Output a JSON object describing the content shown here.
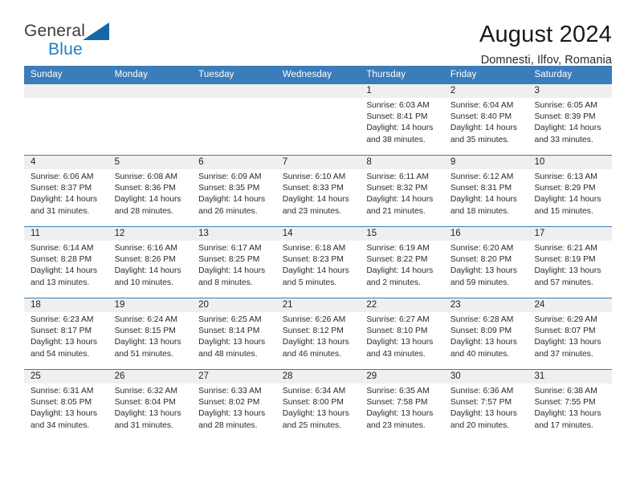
{
  "brand": {
    "name_part1": "General",
    "name_part2": "Blue",
    "triangle_icon": "triangle-icon"
  },
  "header": {
    "title": "August 2024",
    "subtitle": "Domnesti, Ilfov, Romania"
  },
  "calendar": {
    "weekdays": [
      "Sunday",
      "Monday",
      "Tuesday",
      "Wednesday",
      "Thursday",
      "Friday",
      "Saturday"
    ],
    "colors": {
      "header_blue": "#3b7cba",
      "day_band_gray": "#efefef",
      "brand_blue": "#1b7fc4"
    },
    "labels": {
      "sunrise": "Sunrise:",
      "sunset": "Sunset:",
      "daylight": "Daylight:"
    },
    "weeks": [
      [
        {
          "day": "",
          "empty": true
        },
        {
          "day": "",
          "empty": true
        },
        {
          "day": "",
          "empty": true
        },
        {
          "day": "",
          "empty": true
        },
        {
          "day": "1",
          "sunrise": "Sunrise: 6:03 AM",
          "sunset": "Sunset: 8:41 PM",
          "daylight_line1": "Daylight: 14 hours",
          "daylight_line2": "and 38 minutes."
        },
        {
          "day": "2",
          "sunrise": "Sunrise: 6:04 AM",
          "sunset": "Sunset: 8:40 PM",
          "daylight_line1": "Daylight: 14 hours",
          "daylight_line2": "and 35 minutes."
        },
        {
          "day": "3",
          "sunrise": "Sunrise: 6:05 AM",
          "sunset": "Sunset: 8:39 PM",
          "daylight_line1": "Daylight: 14 hours",
          "daylight_line2": "and 33 minutes."
        }
      ],
      [
        {
          "day": "4",
          "sunrise": "Sunrise: 6:06 AM",
          "sunset": "Sunset: 8:37 PM",
          "daylight_line1": "Daylight: 14 hours",
          "daylight_line2": "and 31 minutes."
        },
        {
          "day": "5",
          "sunrise": "Sunrise: 6:08 AM",
          "sunset": "Sunset: 8:36 PM",
          "daylight_line1": "Daylight: 14 hours",
          "daylight_line2": "and 28 minutes."
        },
        {
          "day": "6",
          "sunrise": "Sunrise: 6:09 AM",
          "sunset": "Sunset: 8:35 PM",
          "daylight_line1": "Daylight: 14 hours",
          "daylight_line2": "and 26 minutes."
        },
        {
          "day": "7",
          "sunrise": "Sunrise: 6:10 AM",
          "sunset": "Sunset: 8:33 PM",
          "daylight_line1": "Daylight: 14 hours",
          "daylight_line2": "and 23 minutes."
        },
        {
          "day": "8",
          "sunrise": "Sunrise: 6:11 AM",
          "sunset": "Sunset: 8:32 PM",
          "daylight_line1": "Daylight: 14 hours",
          "daylight_line2": "and 21 minutes."
        },
        {
          "day": "9",
          "sunrise": "Sunrise: 6:12 AM",
          "sunset": "Sunset: 8:31 PM",
          "daylight_line1": "Daylight: 14 hours",
          "daylight_line2": "and 18 minutes."
        },
        {
          "day": "10",
          "sunrise": "Sunrise: 6:13 AM",
          "sunset": "Sunset: 8:29 PM",
          "daylight_line1": "Daylight: 14 hours",
          "daylight_line2": "and 15 minutes."
        }
      ],
      [
        {
          "day": "11",
          "sunrise": "Sunrise: 6:14 AM",
          "sunset": "Sunset: 8:28 PM",
          "daylight_line1": "Daylight: 14 hours",
          "daylight_line2": "and 13 minutes."
        },
        {
          "day": "12",
          "sunrise": "Sunrise: 6:16 AM",
          "sunset": "Sunset: 8:26 PM",
          "daylight_line1": "Daylight: 14 hours",
          "daylight_line2": "and 10 minutes."
        },
        {
          "day": "13",
          "sunrise": "Sunrise: 6:17 AM",
          "sunset": "Sunset: 8:25 PM",
          "daylight_line1": "Daylight: 14 hours",
          "daylight_line2": "and 8 minutes."
        },
        {
          "day": "14",
          "sunrise": "Sunrise: 6:18 AM",
          "sunset": "Sunset: 8:23 PM",
          "daylight_line1": "Daylight: 14 hours",
          "daylight_line2": "and 5 minutes."
        },
        {
          "day": "15",
          "sunrise": "Sunrise: 6:19 AM",
          "sunset": "Sunset: 8:22 PM",
          "daylight_line1": "Daylight: 14 hours",
          "daylight_line2": "and 2 minutes."
        },
        {
          "day": "16",
          "sunrise": "Sunrise: 6:20 AM",
          "sunset": "Sunset: 8:20 PM",
          "daylight_line1": "Daylight: 13 hours",
          "daylight_line2": "and 59 minutes."
        },
        {
          "day": "17",
          "sunrise": "Sunrise: 6:21 AM",
          "sunset": "Sunset: 8:19 PM",
          "daylight_line1": "Daylight: 13 hours",
          "daylight_line2": "and 57 minutes."
        }
      ],
      [
        {
          "day": "18",
          "sunrise": "Sunrise: 6:23 AM",
          "sunset": "Sunset: 8:17 PM",
          "daylight_line1": "Daylight: 13 hours",
          "daylight_line2": "and 54 minutes."
        },
        {
          "day": "19",
          "sunrise": "Sunrise: 6:24 AM",
          "sunset": "Sunset: 8:15 PM",
          "daylight_line1": "Daylight: 13 hours",
          "daylight_line2": "and 51 minutes."
        },
        {
          "day": "20",
          "sunrise": "Sunrise: 6:25 AM",
          "sunset": "Sunset: 8:14 PM",
          "daylight_line1": "Daylight: 13 hours",
          "daylight_line2": "and 48 minutes."
        },
        {
          "day": "21",
          "sunrise": "Sunrise: 6:26 AM",
          "sunset": "Sunset: 8:12 PM",
          "daylight_line1": "Daylight: 13 hours",
          "daylight_line2": "and 46 minutes."
        },
        {
          "day": "22",
          "sunrise": "Sunrise: 6:27 AM",
          "sunset": "Sunset: 8:10 PM",
          "daylight_line1": "Daylight: 13 hours",
          "daylight_line2": "and 43 minutes."
        },
        {
          "day": "23",
          "sunrise": "Sunrise: 6:28 AM",
          "sunset": "Sunset: 8:09 PM",
          "daylight_line1": "Daylight: 13 hours",
          "daylight_line2": "and 40 minutes."
        },
        {
          "day": "24",
          "sunrise": "Sunrise: 6:29 AM",
          "sunset": "Sunset: 8:07 PM",
          "daylight_line1": "Daylight: 13 hours",
          "daylight_line2": "and 37 minutes."
        }
      ],
      [
        {
          "day": "25",
          "sunrise": "Sunrise: 6:31 AM",
          "sunset": "Sunset: 8:05 PM",
          "daylight_line1": "Daylight: 13 hours",
          "daylight_line2": "and 34 minutes."
        },
        {
          "day": "26",
          "sunrise": "Sunrise: 6:32 AM",
          "sunset": "Sunset: 8:04 PM",
          "daylight_line1": "Daylight: 13 hours",
          "daylight_line2": "and 31 minutes."
        },
        {
          "day": "27",
          "sunrise": "Sunrise: 6:33 AM",
          "sunset": "Sunset: 8:02 PM",
          "daylight_line1": "Daylight: 13 hours",
          "daylight_line2": "and 28 minutes."
        },
        {
          "day": "28",
          "sunrise": "Sunrise: 6:34 AM",
          "sunset": "Sunset: 8:00 PM",
          "daylight_line1": "Daylight: 13 hours",
          "daylight_line2": "and 25 minutes."
        },
        {
          "day": "29",
          "sunrise": "Sunrise: 6:35 AM",
          "sunset": "Sunset: 7:58 PM",
          "daylight_line1": "Daylight: 13 hours",
          "daylight_line2": "and 23 minutes."
        },
        {
          "day": "30",
          "sunrise": "Sunrise: 6:36 AM",
          "sunset": "Sunset: 7:57 PM",
          "daylight_line1": "Daylight: 13 hours",
          "daylight_line2": "and 20 minutes."
        },
        {
          "day": "31",
          "sunrise": "Sunrise: 6:38 AM",
          "sunset": "Sunset: 7:55 PM",
          "daylight_line1": "Daylight: 13 hours",
          "daylight_line2": "and 17 minutes."
        }
      ]
    ]
  }
}
